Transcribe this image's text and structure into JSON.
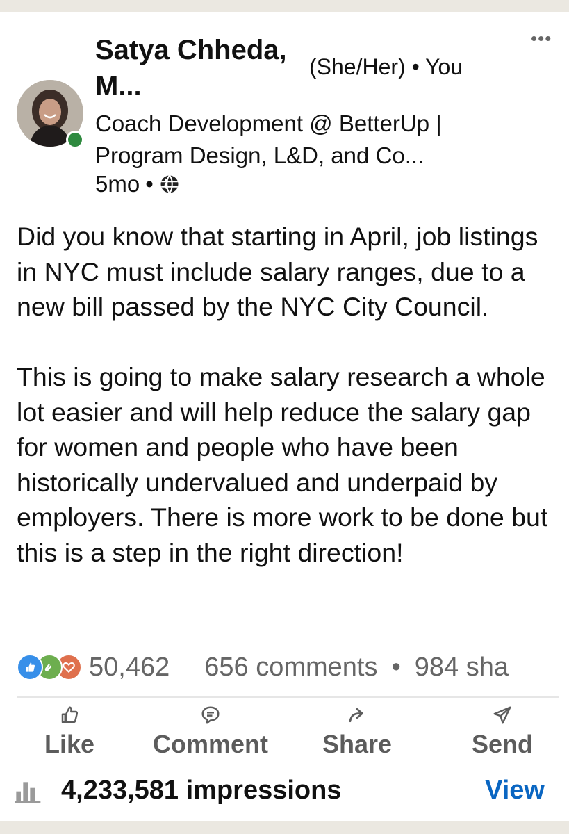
{
  "post": {
    "author": {
      "name": "Satya Chheda, M...",
      "pronouns": "(She/Her)",
      "connection": "You",
      "headline": "Coach Development @ BetterUp | Program Design, L&D, and Co...",
      "time": "5mo",
      "visibility_icon": "globe-icon",
      "avatar_icon": "profile-photo",
      "online_status_color": "#2f8a3f"
    },
    "more_label": "•••",
    "body": [
      "Did you know that starting in April, job listings in NYC must include salary ranges, due to a new bill passed by the NYC City Council.",
      "This is going to make salary research a whole lot easier and will help reduce the salary gap for women and people who have been historically undervalued and underpaid by employers. There is more work to be done but this is a step in the right direction!"
    ],
    "social": {
      "reaction_icons": [
        "like-reaction-icon",
        "celebrate-reaction-icon",
        "love-reaction-icon"
      ],
      "reaction_count": "50,462",
      "comments": "656 comments",
      "shares": "984 sha"
    },
    "actions": [
      {
        "label": "Like",
        "icon": "thumbs-up-icon"
      },
      {
        "label": "Comment",
        "icon": "comment-icon"
      },
      {
        "label": "Share",
        "icon": "share-arrow-icon"
      },
      {
        "label": "Send",
        "icon": "send-icon"
      }
    ],
    "analytics": {
      "impressions": "4,233,581 impressions",
      "view_label": "View",
      "link_color": "#0a66c2"
    }
  }
}
